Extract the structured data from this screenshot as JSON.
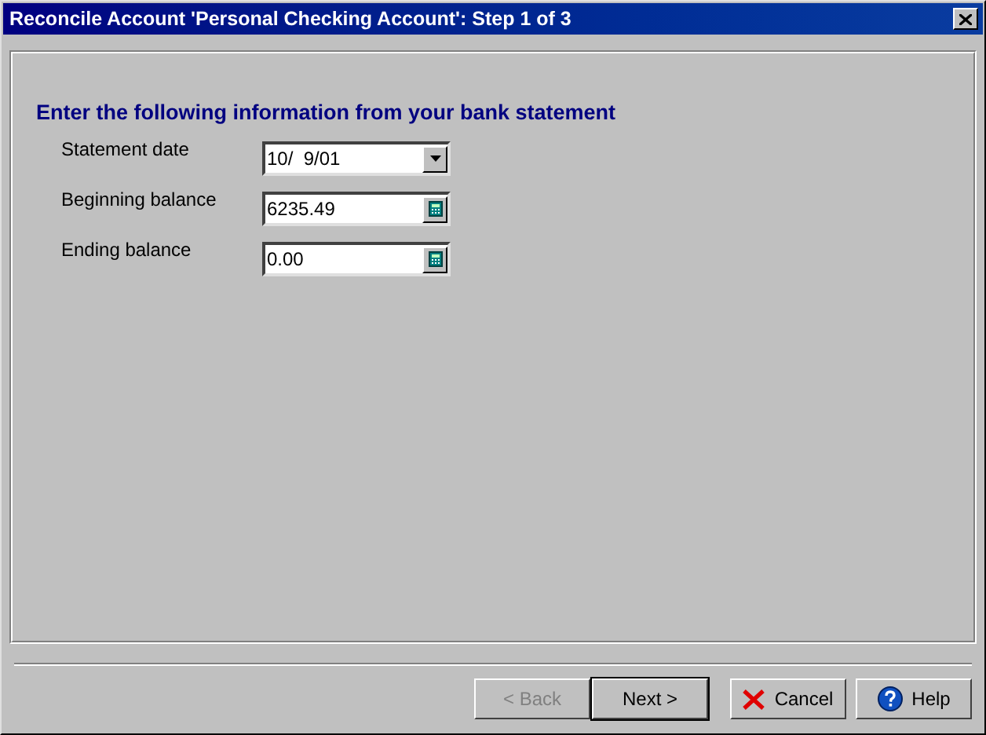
{
  "window": {
    "title": "Reconcile Account 'Personal Checking Account': Step 1 of 3"
  },
  "heading": "Enter the following information from your bank statement",
  "fields": [
    {
      "label": "Statement date",
      "value": "10/  9/01",
      "kind": "dropdown"
    },
    {
      "label": "Beginning balance",
      "value": "6235.49",
      "kind": "calculator"
    },
    {
      "label": "Ending balance",
      "value": "0.00",
      "kind": "calculator"
    }
  ],
  "buttons": [
    {
      "label": "< Back",
      "disabled": true,
      "default": false,
      "kind": "plain"
    },
    {
      "label": "Next >",
      "disabled": false,
      "default": true,
      "kind": "plain"
    },
    {
      "label": "Cancel",
      "disabled": false,
      "default": false,
      "kind": "cancel"
    },
    {
      "label": "Help",
      "disabled": false,
      "default": false,
      "kind": "help"
    }
  ]
}
